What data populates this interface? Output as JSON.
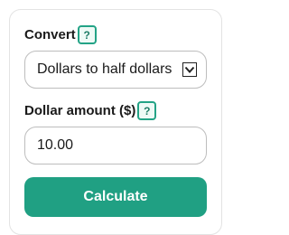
{
  "convert": {
    "label": "Convert",
    "help": "?",
    "selected": "Dollars to half dollars"
  },
  "amount": {
    "label": "Dollar amount ($)",
    "help": "?",
    "value": "10.00"
  },
  "calculate_label": "Calculate",
  "colors": {
    "accent": "#20a083",
    "help_border": "#23a386"
  }
}
